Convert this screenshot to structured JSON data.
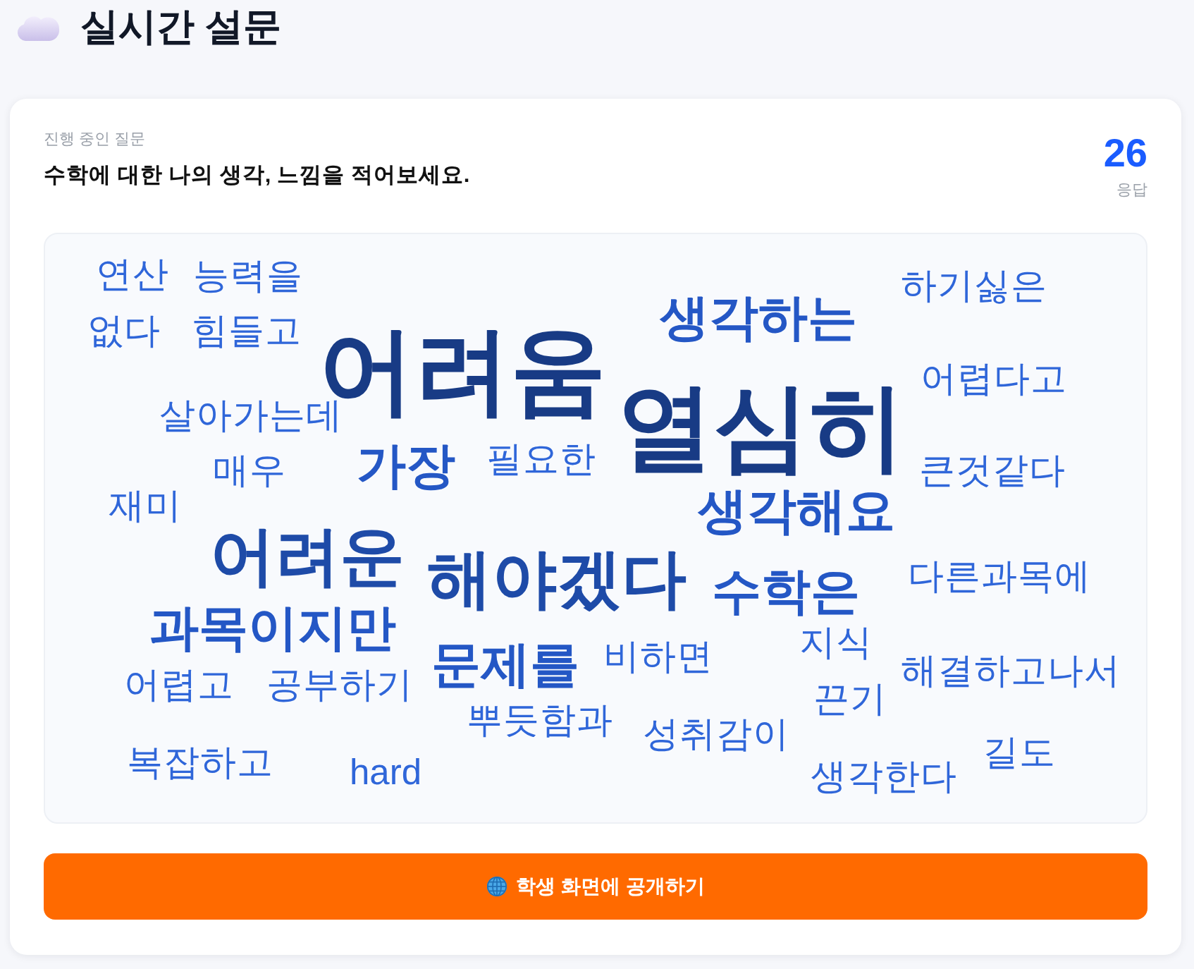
{
  "header": {
    "title": "실시간 설문"
  },
  "question": {
    "label": "진행 중인 질문",
    "text": "수학에 대한 나의 생각, 느낌을 적어보세요.",
    "response_count": "26",
    "response_label": "응답"
  },
  "word_cloud": {
    "words": [
      {
        "text": "연산",
        "kind": "low"
      },
      {
        "text": "능력을",
        "kind": "low"
      },
      {
        "text": "하기싫은",
        "kind": "low"
      },
      {
        "text": "없다",
        "kind": "low"
      },
      {
        "text": "힘들고",
        "kind": "low"
      },
      {
        "text": "생각하는",
        "kind": "medium"
      },
      {
        "text": "살아가는데",
        "kind": "low"
      },
      {
        "text": "어려움",
        "kind": "highest"
      },
      {
        "text": "매우",
        "kind": "low"
      },
      {
        "text": "가장",
        "kind": "medium"
      },
      {
        "text": "필요한",
        "kind": "low"
      },
      {
        "text": "열심히",
        "kind": "highest"
      },
      {
        "text": "어렵다고",
        "kind": "low"
      },
      {
        "text": "큰것같다",
        "kind": "low"
      },
      {
        "text": "재미",
        "kind": "low"
      },
      {
        "text": "생각해요",
        "kind": "medium"
      },
      {
        "text": "어려운",
        "kind": "high"
      },
      {
        "text": "해야겠다",
        "kind": "high"
      },
      {
        "text": "수학은",
        "kind": "medium"
      },
      {
        "text": "다른과목에",
        "kind": "low"
      },
      {
        "text": "과목이지만",
        "kind": "medium"
      },
      {
        "text": "문제를",
        "kind": "medium"
      },
      {
        "text": "비하면",
        "kind": "low"
      },
      {
        "text": "지식",
        "kind": "low"
      },
      {
        "text": "어렵고",
        "kind": "low"
      },
      {
        "text": "공부하기",
        "kind": "low"
      },
      {
        "text": "해결하고나서",
        "kind": "low"
      },
      {
        "text": "뿌듯함과",
        "kind": "low"
      },
      {
        "text": "성취감이",
        "kind": "low"
      },
      {
        "text": "끈기",
        "kind": "low"
      },
      {
        "text": "복잡하고",
        "kind": "low"
      },
      {
        "text": "hard",
        "kind": "low"
      },
      {
        "text": "생각한다",
        "kind": "low"
      },
      {
        "text": "길도",
        "kind": "low"
      }
    ]
  },
  "publish_button": {
    "label": "학생 화면에 공개하기"
  }
}
